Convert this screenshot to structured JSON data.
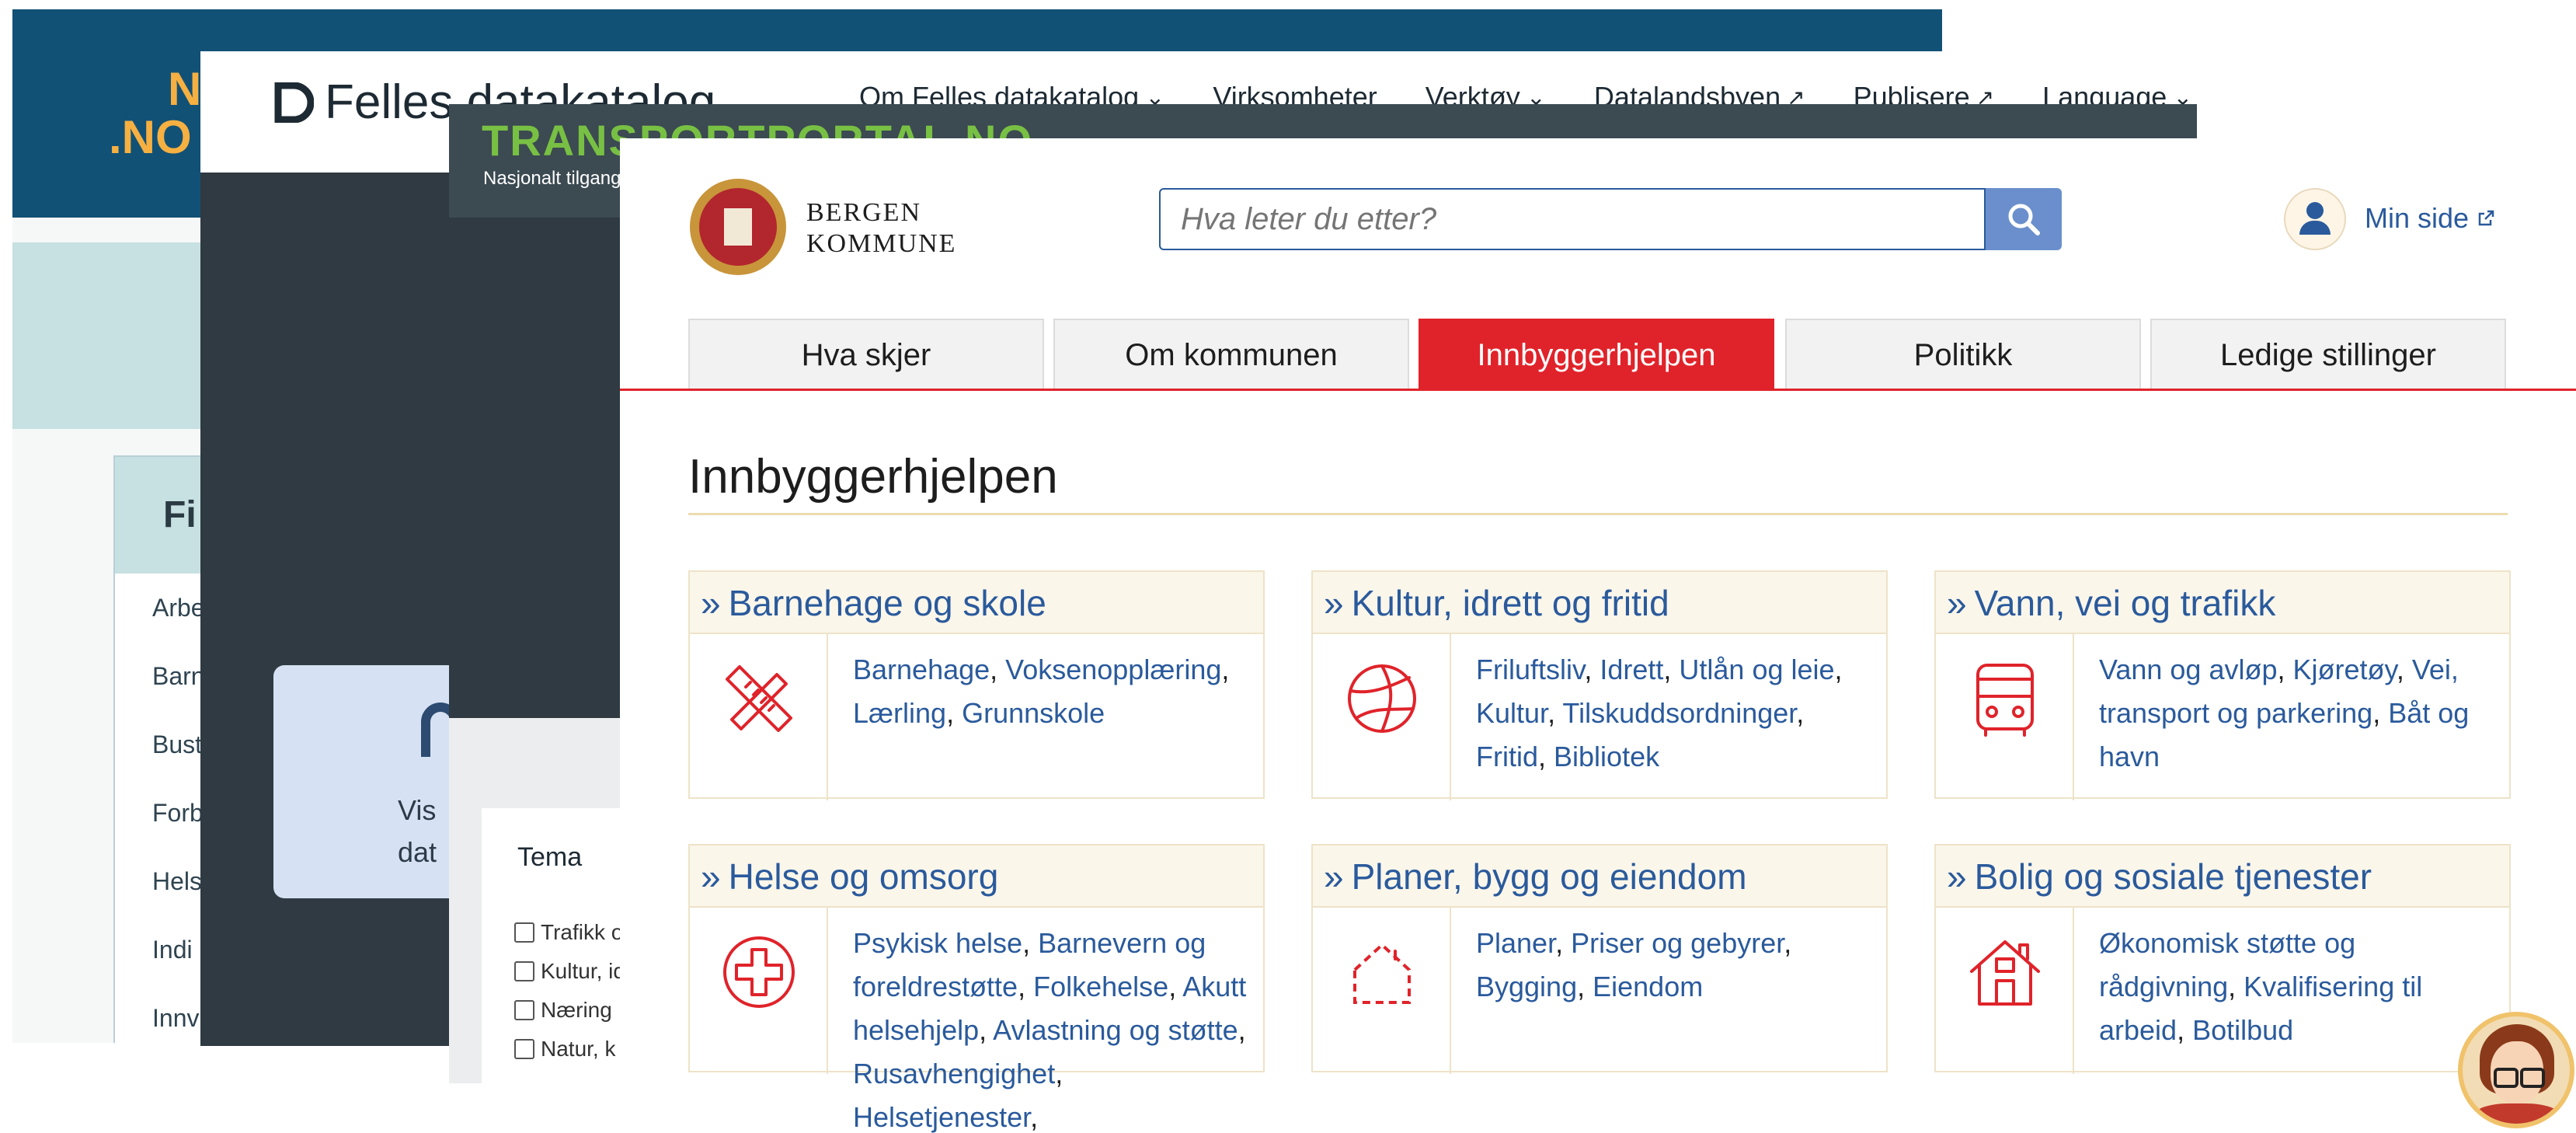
{
  "no_site": {
    "logo_line1": "N",
    "logo_line2": ".NO",
    "filter_title": "Fi",
    "filter_items": [
      "Arbe",
      "Barn",
      "Bust",
      "Forb",
      "Hels",
      "Indi",
      "Innv"
    ]
  },
  "fdk": {
    "brand": "Felles datakatalog",
    "nav": [
      "Om Felles datakatalog",
      "Virksomheter",
      "Verktøy",
      "Datalandsbyen",
      "Publisere",
      "Language"
    ],
    "card_text_line1": "Vis",
    "card_text_line2": "dat"
  },
  "transport": {
    "title": "TRANSPORTPORTAL.NO",
    "subtitle": "Nasjonalt tilgangsp",
    "tema": "Tema",
    "checkboxes": [
      "Trafikk o",
      "Kultur, id",
      "Næring",
      "Natur, k"
    ]
  },
  "bergen": {
    "municipality_line1": "BERGEN",
    "municipality_line2": "KOMMUNE",
    "search_placeholder": "Hva leter du etter?",
    "min_side": "Min side",
    "tabs": [
      "Hva skjer",
      "Om kommunen",
      "Innbyggerhjelpen",
      "Politikk",
      "Ledige stillinger"
    ],
    "active_tab": "Innbyggerhjelpen",
    "page_title": "Innbyggerhjelpen",
    "categories": [
      {
        "title": "Barnehage og skole",
        "icon": "ruler-pencil-icon",
        "links": [
          "Barnehage",
          "Voksenopplæring",
          "Lærling",
          "Grunnskole"
        ]
      },
      {
        "title": "Kultur, idrett og fritid",
        "icon": "volleyball-icon",
        "links": [
          "Friluftsliv",
          "Idrett",
          "Utlån og leie",
          "Kultur",
          "Tilskuddsordninger",
          "Fritid",
          "Bibliotek"
        ]
      },
      {
        "title": "Vann, vei og trafikk",
        "icon": "bus-icon",
        "links": [
          "Vann og avløp",
          "Kjøretøy",
          "Vei, transport og parkering",
          "Båt og havn"
        ]
      },
      {
        "title": "Helse og omsorg",
        "icon": "medical-cross-icon",
        "links": [
          "Psykisk helse",
          "Barnevern og foreldrestøtte",
          "Folkehelse",
          "Akutt helsehjelp",
          "Avlastning og støtte",
          "Rusavhengighet",
          "Helsetjenester"
        ]
      },
      {
        "title": "Planer, bygg og eiendom",
        "icon": "house-outline-icon",
        "links": [
          "Planer",
          "Priser og gebyrer",
          "Bygging",
          "Eiendom"
        ]
      },
      {
        "title": "Bolig og sosiale tjenester",
        "icon": "house-icon",
        "links": [
          "Økonomisk støtte og rådgivning",
          "Kvalifisering til arbeid",
          "Botilbud"
        ]
      }
    ]
  },
  "colors": {
    "bergen_red": "#e0232a",
    "link_blue": "#2a5a9c",
    "fdk_dark": "#2f3a42",
    "no_blue": "#125176",
    "transport_green": "#78c043"
  }
}
